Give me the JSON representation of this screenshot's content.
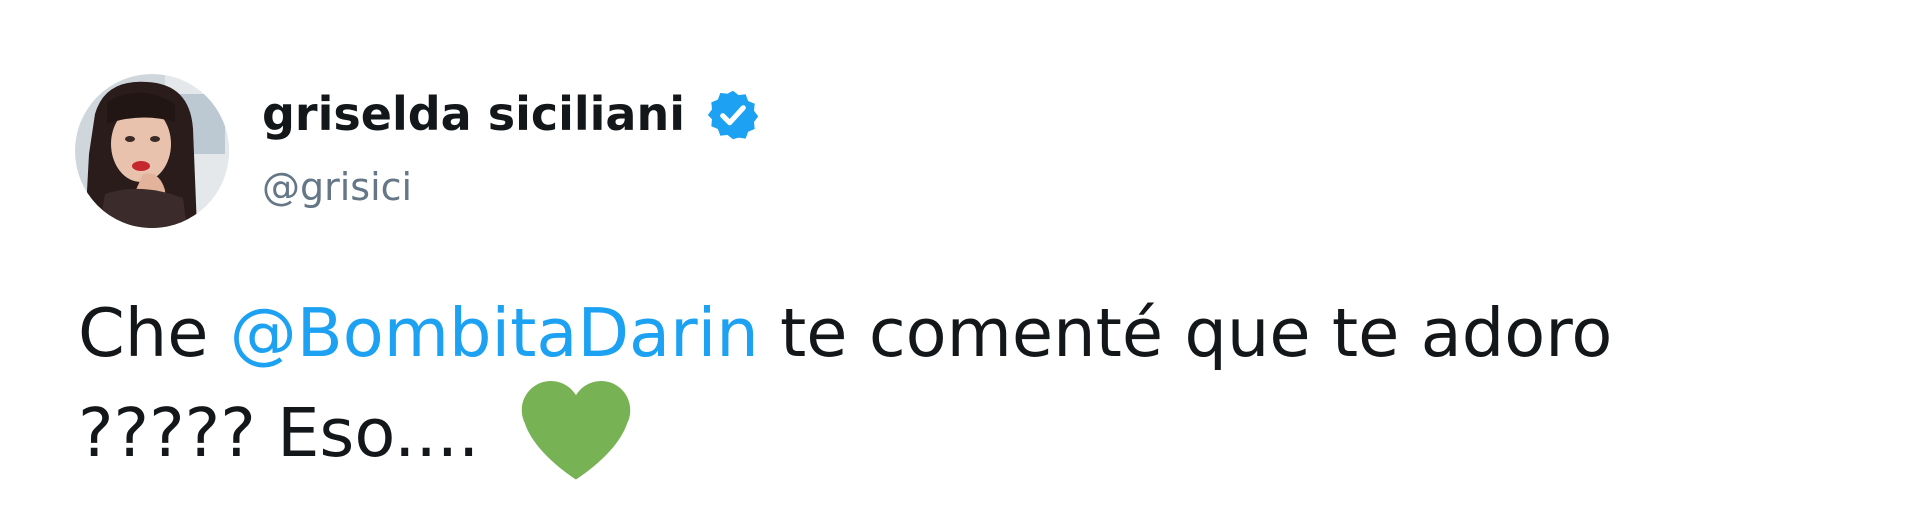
{
  "user": {
    "display_name": "griselda siciliani",
    "handle": "@grisici",
    "verified": true,
    "verified_color": "#1da1f2",
    "avatar_icon": "profile-photo"
  },
  "tweet": {
    "prefix": "Che ",
    "mention": "@BombitaDarin",
    "suffix": " te comenté que te adoro",
    "line2": "????? Eso.... ",
    "emoji": "green-heart",
    "emoji_color": "#77b255",
    "mention_color": "#1da1f2"
  }
}
